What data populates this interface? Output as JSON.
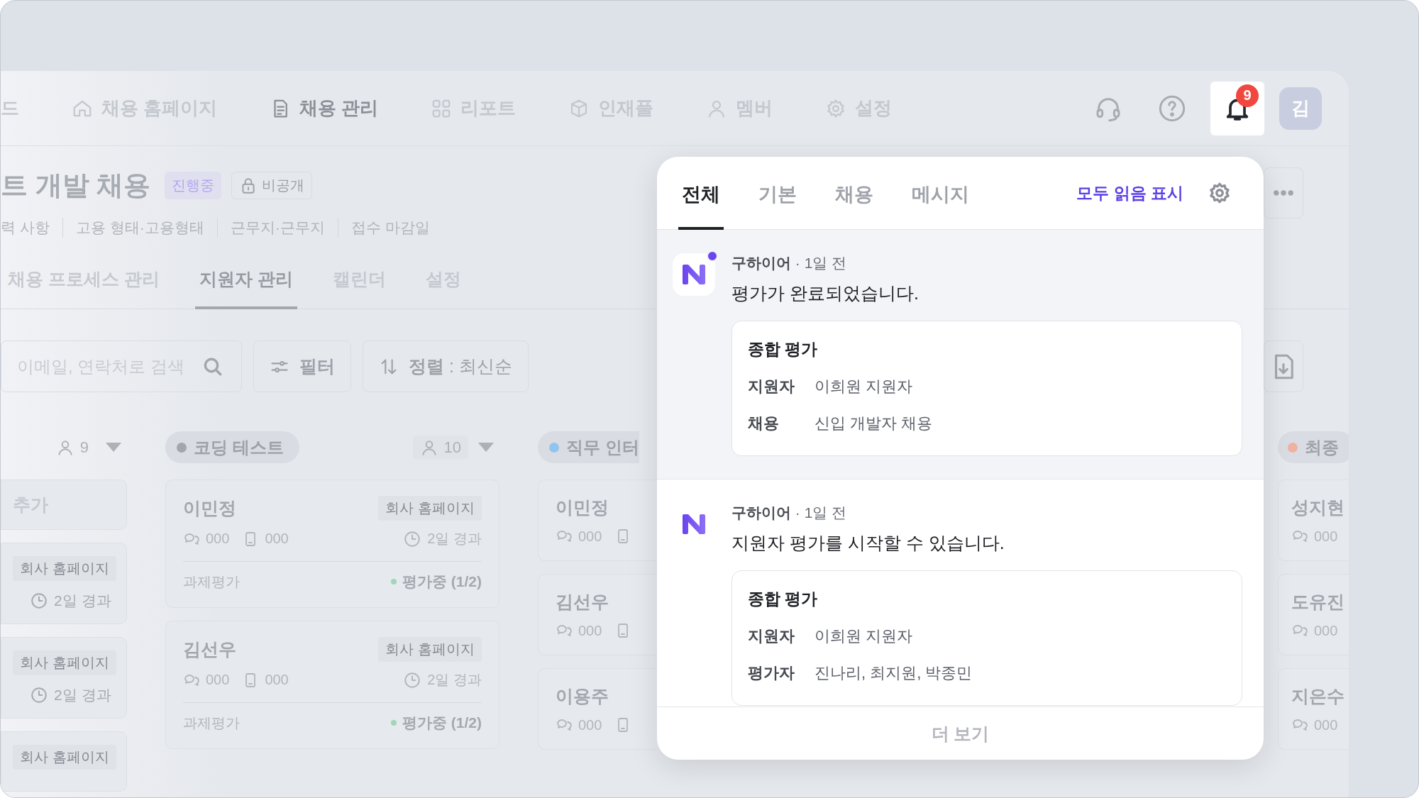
{
  "nav": {
    "items": [
      {
        "label": "드",
        "selected": false
      },
      {
        "label": "채용 홈페이지",
        "selected": false
      },
      {
        "label": "채용 관리",
        "selected": true
      },
      {
        "label": "리포트",
        "selected": false
      },
      {
        "label": "인재풀",
        "selected": false
      },
      {
        "label": "멤버",
        "selected": false
      },
      {
        "label": "설정",
        "selected": false
      }
    ],
    "notification_count": "9",
    "avatar": "김"
  },
  "job": {
    "title": "트 개발 채용",
    "status": "진행중",
    "visibility": "비공개",
    "meta": [
      "력 사항",
      "고용 형태·고용형태",
      "근무지·근무지",
      "접수 마감일"
    ]
  },
  "tabs": [
    {
      "label": "채용 프로세스 관리",
      "selected": false
    },
    {
      "label": "지원자 관리",
      "selected": true
    },
    {
      "label": "캘린더",
      "selected": false
    },
    {
      "label": "설정",
      "selected": false
    }
  ],
  "toolbar": {
    "search_placeholder": "이메일, 연락처로 검색",
    "filter": "필터",
    "sort": "**정렬** : 최신순"
  },
  "columns": [
    {
      "count": "9",
      "cards": [
        {
          "kind": "add",
          "label": "추가"
        },
        {
          "kind": "mini",
          "source": "회사 홈페이지",
          "elapsed": "2일 경과"
        },
        {
          "kind": "mini",
          "source": "회사 홈페이지",
          "elapsed": "2일 경과"
        },
        {
          "kind": "mini",
          "source": "회사 홈페이지"
        }
      ]
    },
    {
      "title": "코딩 테스트",
      "color": "#a3a7ad",
      "count": "10",
      "cards": [
        {
          "kind": "full",
          "name": "이민정",
          "source": "회사 홈페이지",
          "messages": "000",
          "calls": "000",
          "elapsed": "2일 경과",
          "step": "과제평가",
          "status": "평가중 (1/2)"
        },
        {
          "kind": "full",
          "name": "김선우",
          "source": "회사 홈페이지",
          "messages": "000",
          "calls": "000",
          "elapsed": "2일 경과",
          "step": "과제평가",
          "status": "평가중 (1/2)"
        }
      ]
    },
    {
      "title": "직무 인터",
      "color": "#92c5ee",
      "cards": [
        {
          "kind": "short",
          "name": "이민정",
          "messages": "000"
        },
        {
          "kind": "short",
          "name": "김선우",
          "messages": "000"
        },
        {
          "kind": "short",
          "name": "이용주",
          "messages": "000"
        }
      ]
    },
    {
      "title": "최종",
      "color": "#efb2a0",
      "cards": [
        {
          "kind": "short",
          "name": "성지현",
          "messages": "000"
        },
        {
          "kind": "short",
          "name": "도유진",
          "messages": "000"
        },
        {
          "kind": "short",
          "name": "지은수",
          "messages": "000"
        }
      ]
    }
  ],
  "notifications": {
    "tabs": [
      {
        "label": "전체",
        "selected": true
      },
      {
        "label": "기본",
        "selected": false
      },
      {
        "label": "채용",
        "selected": false
      },
      {
        "label": "메시지",
        "selected": false
      }
    ],
    "mark_all_read": "모두 읽음 표시",
    "items": [
      {
        "unread": true,
        "meta": "**구하이어** · 1일 전",
        "message": "평가가 완료되었습니다.",
        "card": {
          "title": "종합 평가",
          "rows": [
            {
              "label": "지원자",
              "value": "이희원 지원자"
            },
            {
              "label": "채용",
              "value": "신입 개발자 채용"
            }
          ]
        }
      },
      {
        "unread": false,
        "meta": "**구하이어** · 1일 전",
        "message": "지원자 평가를 시작할 수 있습니다.",
        "card": {
          "title": "종합 평가",
          "rows": [
            {
              "label": "지원자",
              "value": "이희원 지원자"
            },
            {
              "label": "평가자",
              "value": "진나리, 최지원, 박종민"
            }
          ]
        }
      }
    ],
    "more": "더 보기"
  }
}
